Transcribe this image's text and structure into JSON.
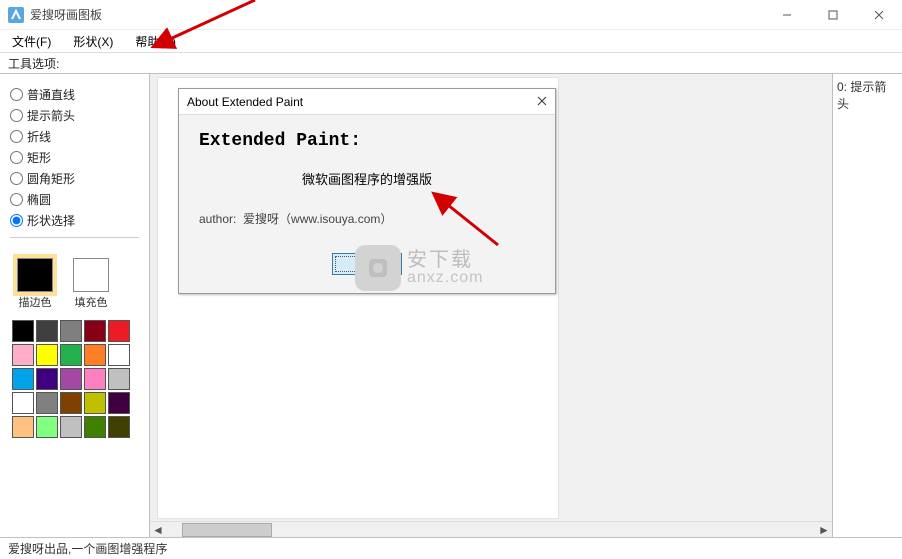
{
  "titlebar": {
    "title": "爱搜呀画图板"
  },
  "menubar": {
    "file": "文件(F)",
    "shape": "形状(X)",
    "help": "帮助(H)"
  },
  "toolopts": {
    "label": "工具选项:"
  },
  "tools": {
    "items": [
      {
        "label": "普通直线"
      },
      {
        "label": "提示箭头"
      },
      {
        "label": "折线"
      },
      {
        "label": "矩形"
      },
      {
        "label": "圆角矩形"
      },
      {
        "label": "椭圆"
      },
      {
        "label": "形状选择"
      }
    ],
    "selected_index": 6
  },
  "colors": {
    "stroke_label": "描边色",
    "fill_label": "填充色",
    "stroke": "#000000",
    "fill": "#ffffff",
    "palette": [
      "#000000",
      "#3f3f3f",
      "#7f7f7f",
      "#880015",
      "#ed1c24",
      "#ffaec9",
      "#ffff00",
      "#22b14c",
      "#ff7f27",
      "#ffffff",
      "#00a2e8",
      "#3f0080",
      "#a349a4",
      "#ff80c0",
      "#c0c0c0",
      "#ffffff",
      "#808080",
      "#804000",
      "#c0c000",
      "#400040",
      "#ffc080",
      "#80ff80",
      "#c0c0c0",
      "#408000",
      "#404000"
    ]
  },
  "right_panel": {
    "item0": "0: 提示箭头"
  },
  "statusbar": {
    "text": "爱搜呀出品,一个画图增强程序"
  },
  "dialog": {
    "title": "About Extended Paint",
    "heading": "Extended Paint:",
    "subtitle": "微软画图程序的增强版",
    "author": "author:  爱搜呀（www.isouya.com）",
    "ok": "OK"
  },
  "watermark": {
    "top": "安下载",
    "bottom": "anxz.com"
  }
}
